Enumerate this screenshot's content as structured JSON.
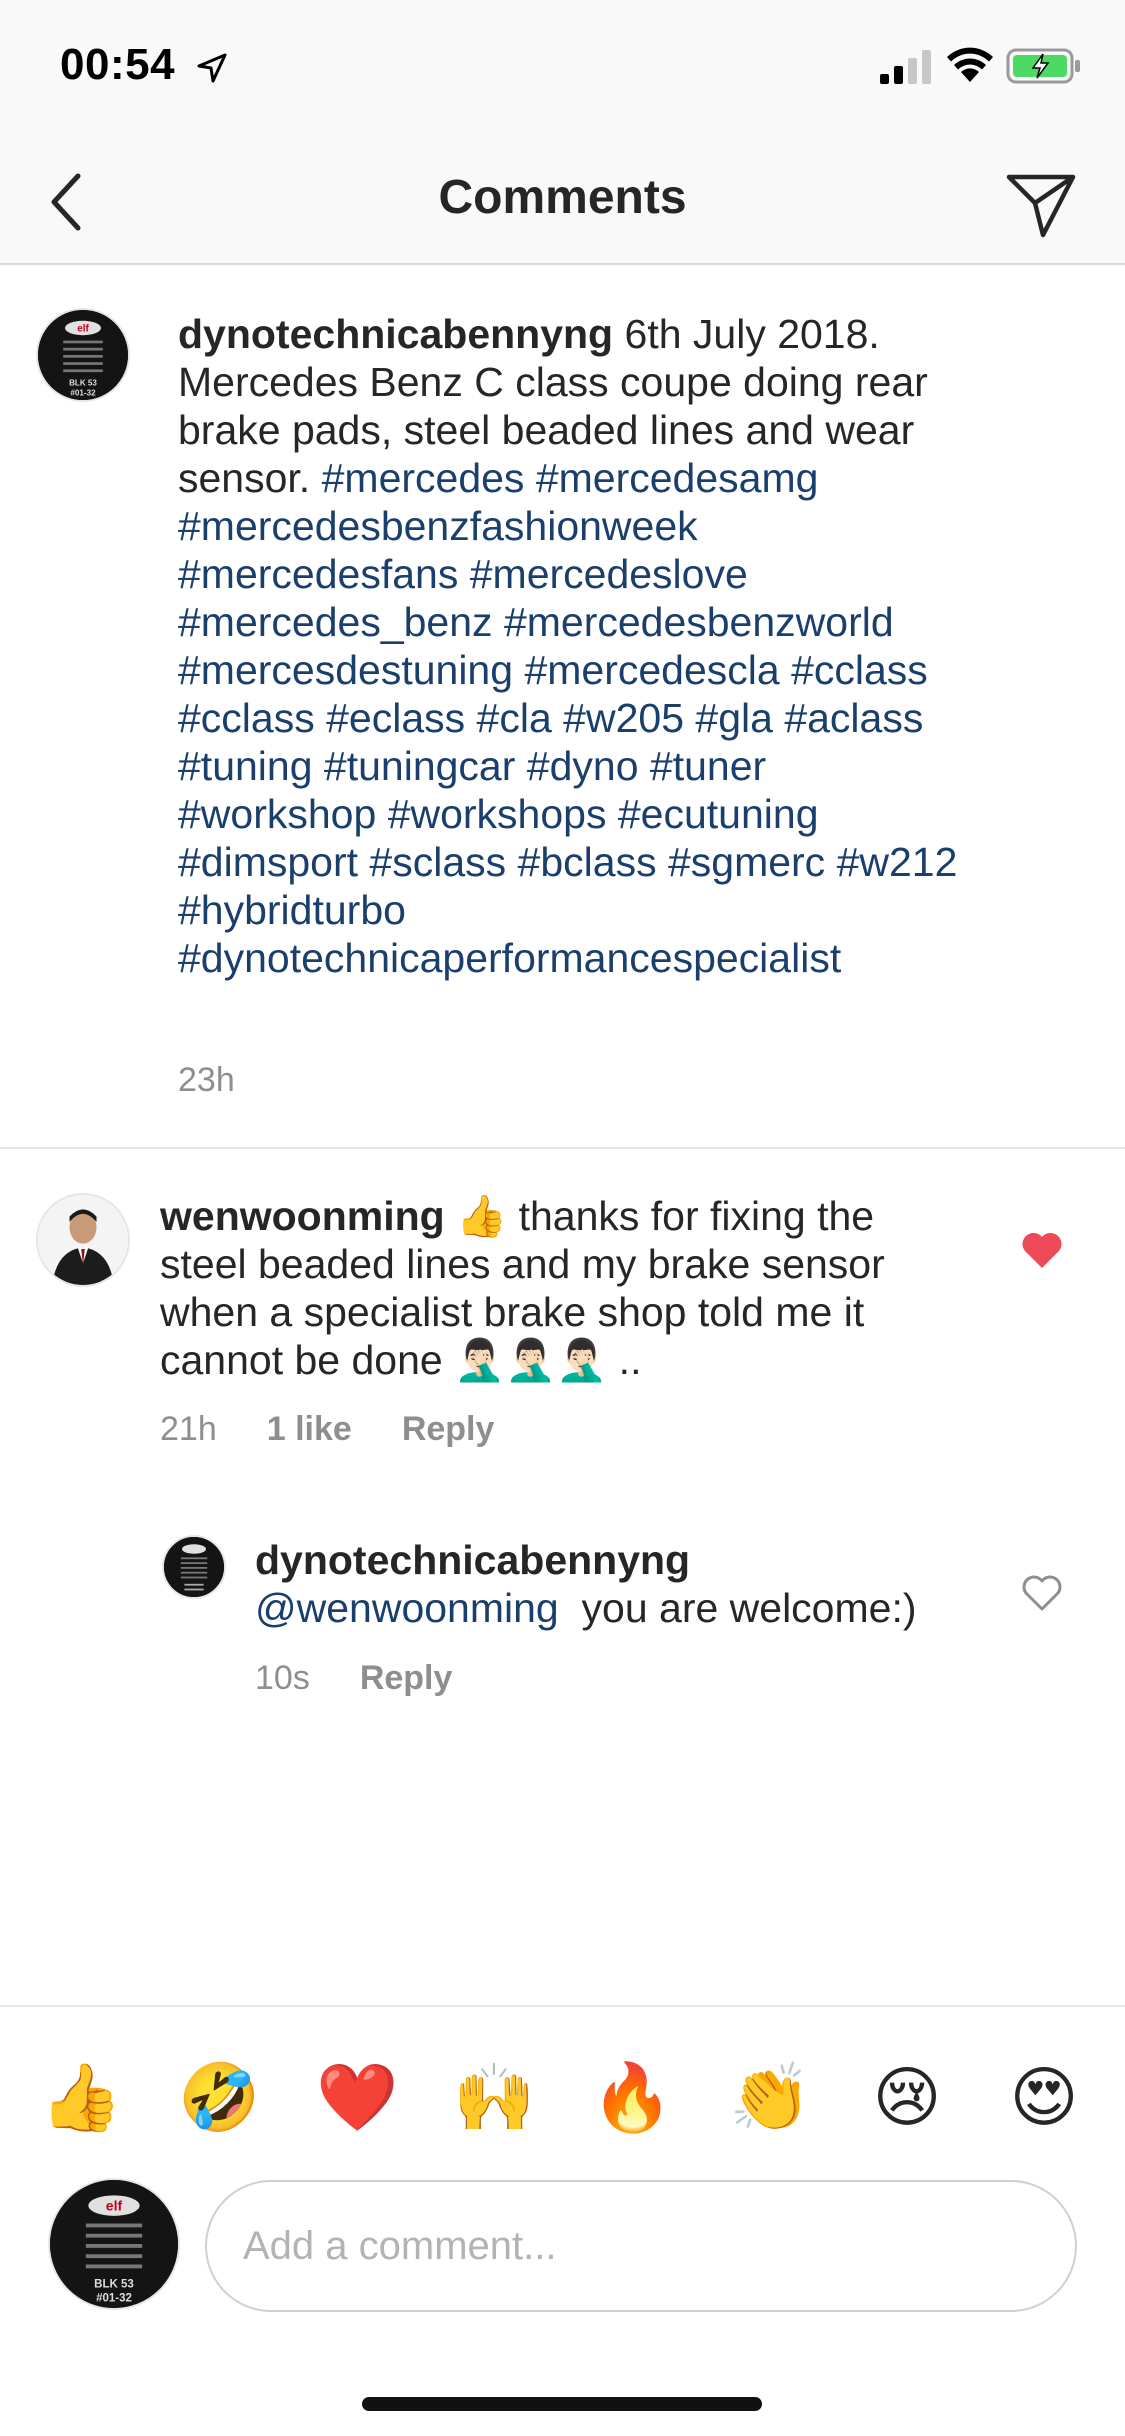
{
  "status_bar": {
    "time": "00:54"
  },
  "nav": {
    "title": "Comments"
  },
  "caption": {
    "username": "dynotechnicabennyng",
    "text": "6th July 2018. Mercedes Benz C class coupe doing rear brake pads, steel beaded lines and wear sensor.",
    "hashtags": [
      "#mercedes",
      "#mercedesamg",
      "#mercedesbenzfashionweek",
      "#mercedesfans",
      "#mercedeslove",
      "#mercedes_benz",
      "#mercedesbenzworld",
      "#mercesdestuning",
      "#mercedescla",
      "#cclass",
      "#cclass",
      "#eclass",
      "#cla",
      "#w205",
      "#gla",
      "#aclass",
      "#tuning",
      "#tuningcar",
      "#dyno",
      "#tuner",
      "#workshop",
      "#workshops",
      "#ecutuning",
      "#dimsport",
      "#sclass",
      "#bclass",
      "#sgmerc",
      "#w212",
      "#hybridturbo",
      "#dynotechnicaperformancespecialist"
    ],
    "time": "23h"
  },
  "comment1": {
    "username": "wenwoonming",
    "emoji": "👍",
    "text": "thanks for fixing the steel beaded lines and my brake sensor when a specialist brake shop told me it cannot be done",
    "trailing_emojis": "🤦🏻‍♂️🤦🏻‍♂️🤦🏻‍♂️",
    "trailing_text": "..",
    "time": "21h",
    "likes": "1 like",
    "reply_label": "Reply",
    "liked": true,
    "like_color": "#ed4956"
  },
  "reply1": {
    "username": "dynotechnicabennyng",
    "mention": "@wenwoonming",
    "text": "you are welcome:)",
    "time": "10s",
    "reply_label": "Reply",
    "liked": false
  },
  "avatar_sign": {
    "brand": "elf",
    "line1": "BLK 53",
    "line2": "#01-32"
  },
  "quick_emojis": [
    "👍",
    "🤣",
    "❤️",
    "🙌",
    "🔥",
    "👏",
    "😢",
    "😍"
  ],
  "composer": {
    "placeholder": "Add a comment..."
  },
  "colors": {
    "link": "#1b3f6c",
    "meta": "#8e8e8e",
    "heart": "#ed4956",
    "battery": "#4cd964"
  }
}
